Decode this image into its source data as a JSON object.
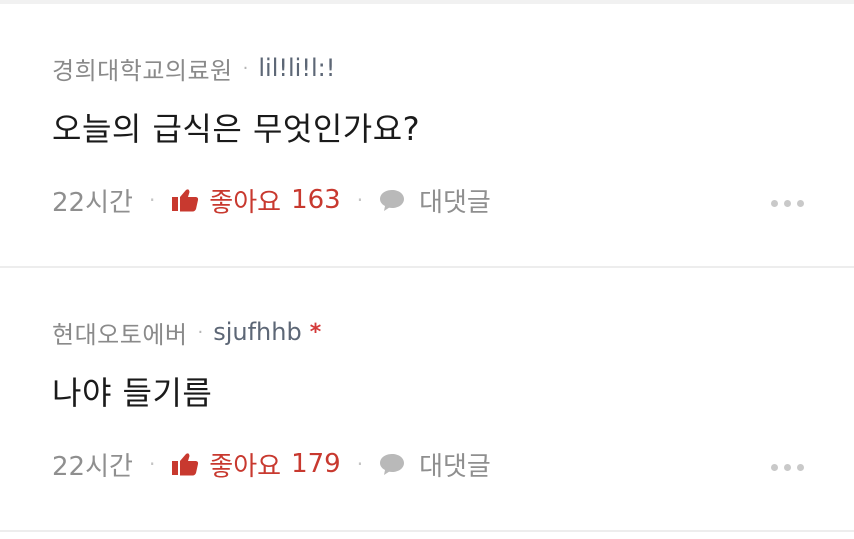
{
  "comments": [
    {
      "school": "경희대학교의료원",
      "nickname": "lil!li!l:!",
      "text": "오늘의 급식은 무엇인가요?",
      "time": "22시간",
      "like_label": "좋아요",
      "like_count": "163",
      "reply_label": "대댓글",
      "has_star": false
    },
    {
      "school": "현대오토에버",
      "nickname": "sjufhhb",
      "star": "*",
      "text": "나야 들기름",
      "time": "22시간",
      "like_label": "좋아요",
      "like_count": "179",
      "reply_label": "대댓글",
      "has_star": true
    }
  ],
  "separator_dot": "·",
  "colors": {
    "like": "#c8392f",
    "star": "#d43a3a",
    "muted": "#8f8f8f",
    "nickname": "#5d6776"
  },
  "icons": {
    "like": "thumbs-up-icon",
    "reply": "speech-bubble-icon",
    "more": "more-dots-icon"
  }
}
